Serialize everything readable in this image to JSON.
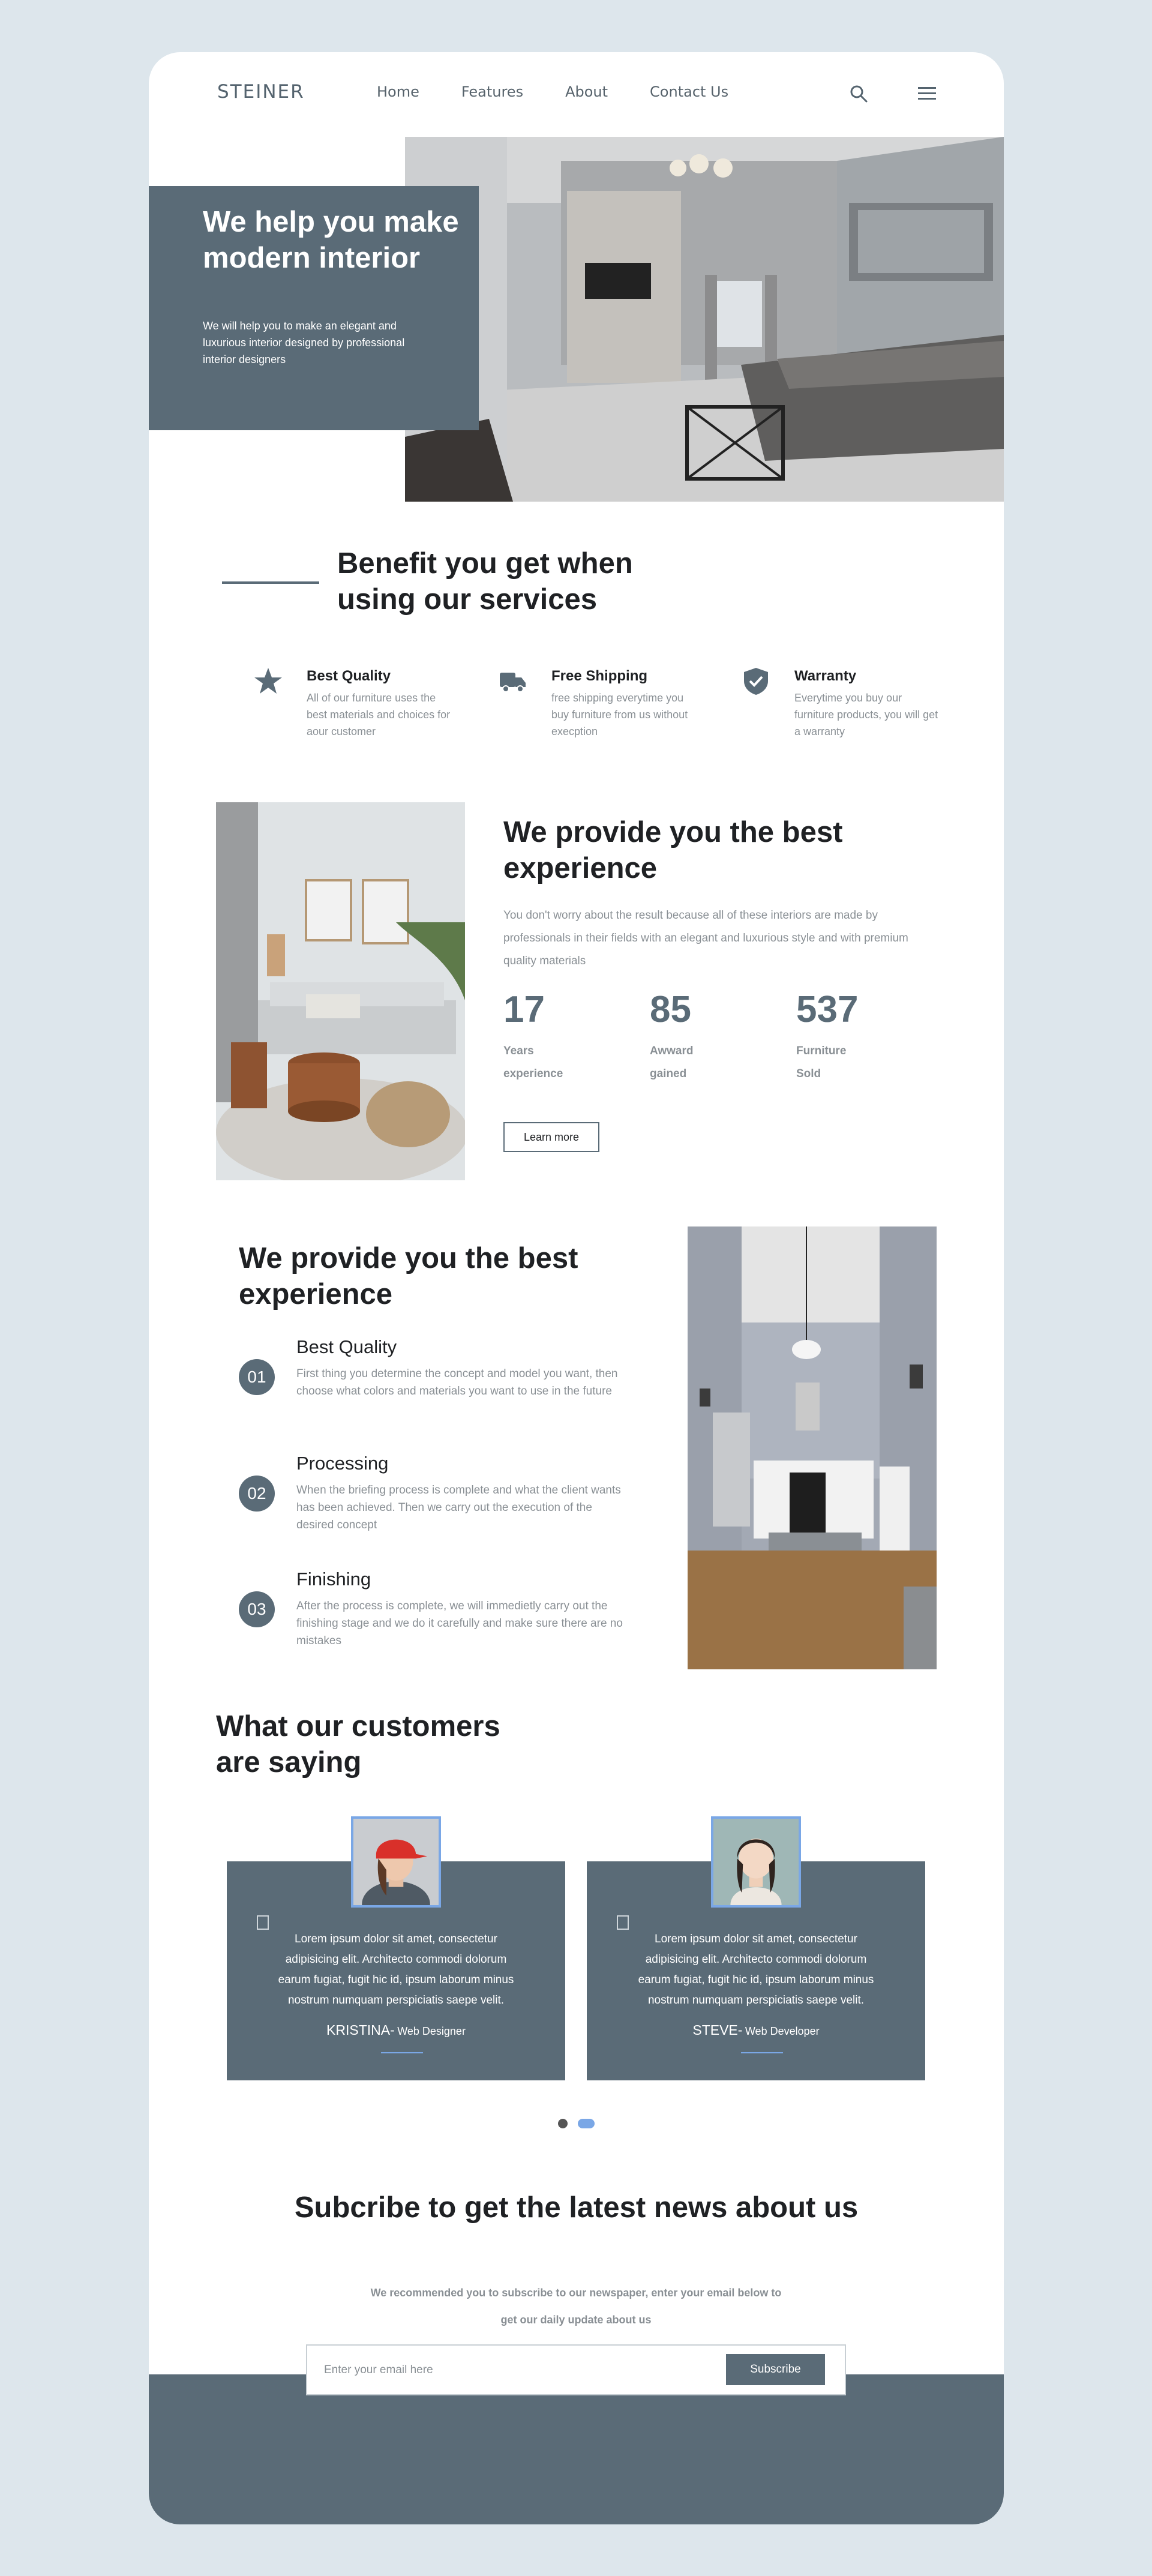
{
  "brand": {
    "logo": "STEINER"
  },
  "nav": {
    "items": [
      "Home",
      "Features",
      "About",
      "Contact Us"
    ],
    "search_icon": "search-icon",
    "menu_icon": "hamburger-menu-icon"
  },
  "hero": {
    "title": "We help you make modern interior",
    "subtitle": "We will help you to make an elegant and luxurious interior designed by professional interior designers"
  },
  "benefits": {
    "title": "Benefit you get when using our services",
    "items": [
      {
        "icon": "star-icon",
        "title": "Best Quality",
        "desc": "All of our furniture uses the best materials and choices for aour customer"
      },
      {
        "icon": "truck-icon",
        "title": "Free Shipping",
        "desc": "free shipping everytime you buy furniture from us without execption"
      },
      {
        "icon": "shield-check-icon",
        "title": "Warranty",
        "desc": "Everytime you buy our furniture products, you will get a warranty"
      }
    ]
  },
  "experience": {
    "title": "We provide you the best experience",
    "desc": "You don't worry about the result because all of these interiors are made by professionals in their fields with an elegant and luxurious style and with premium quality materials",
    "stats": [
      {
        "num": "17",
        "label": "Years experience"
      },
      {
        "num": "85",
        "label": "Awward gained"
      },
      {
        "num": "537",
        "label": "Furniture Sold"
      }
    ],
    "button": "Learn more"
  },
  "process": {
    "title": "We provide you the best experience",
    "steps": [
      {
        "num": "01",
        "title": "Best Quality",
        "desc": "First thing you determine the concept and model you want, then choose what colors and materials you want to use in the future"
      },
      {
        "num": "02",
        "title": "Processing",
        "desc": "When the briefing process is complete and what the client wants has been achieved. Then we carry out the execution of the desired concept"
      },
      {
        "num": "03",
        "title": "Finishing",
        "desc": "After the process is complete, we will immedietly carry out the finishing stage and we do it carefully and make sure there are no mistakes"
      }
    ]
  },
  "testimonials": {
    "title": "What our customers are saying",
    "items": [
      {
        "text": "Lorem ipsum dolor sit amet, consectetur adipisicing elit. Architecto commodi dolorum earum fugiat, fugit hic id, ipsum laborum minus nostrum numquam perspiciatis saepe velit.",
        "name": "KRISTINA-",
        "role": "Web Designer"
      },
      {
        "text": "Lorem ipsum dolor sit amet, consectetur adipisicing elit. Architecto commodi dolorum earum fugiat, fugit hic id, ipsum laborum minus nostrum numquam perspiciatis saepe velit.",
        "name": "STEVE-",
        "role": "Web Developer"
      }
    ]
  },
  "subscribe": {
    "title": "Subcribe to get the latest news about us",
    "desc": "We recommended you to subscribe to our newspaper, enter your email below to get our daily update about us",
    "placeholder": "Enter your email here",
    "button": "Subscribe"
  },
  "colors": {
    "accent": "#5a6b77",
    "highlight": "#7aa7e6",
    "page_bg": "#dde6ec"
  }
}
